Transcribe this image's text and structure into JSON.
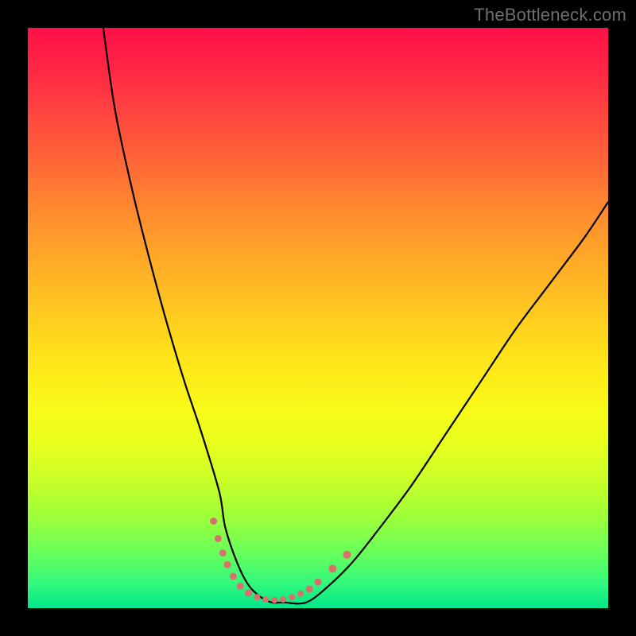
{
  "chart_data": {
    "type": "line",
    "title": "",
    "xlabel": "",
    "ylabel": "",
    "xlim": [
      0,
      100
    ],
    "ylim": [
      0,
      100
    ],
    "series": [
      {
        "name": "bottleneck-curve",
        "x": [
          13,
          15,
          18,
          21,
          24,
          27,
          30,
          33,
          34,
          36,
          38,
          40,
          42,
          44,
          48,
          52,
          56,
          60,
          66,
          72,
          78,
          84,
          90,
          96,
          100
        ],
        "values": [
          100,
          86,
          72,
          60,
          49,
          39,
          30,
          20,
          14,
          8,
          4,
          2,
          1,
          1,
          1,
          4,
          8,
          13,
          21,
          30,
          39,
          48,
          56,
          64,
          70
        ]
      }
    ],
    "markers": {
      "name": "highlighted-points",
      "color": "#d9716b",
      "points": [
        {
          "x": 32.0,
          "y": 15.0,
          "r": 4.5
        },
        {
          "x": 32.8,
          "y": 12.0,
          "r": 4.5
        },
        {
          "x": 33.6,
          "y": 9.5,
          "r": 4.5
        },
        {
          "x": 34.4,
          "y": 7.5,
          "r": 4.5
        },
        {
          "x": 35.4,
          "y": 5.5,
          "r": 4.5
        },
        {
          "x": 36.6,
          "y": 3.8,
          "r": 4.5
        },
        {
          "x": 38.0,
          "y": 2.6,
          "r": 4.5
        },
        {
          "x": 39.5,
          "y": 1.9,
          "r": 4.0
        },
        {
          "x": 41.0,
          "y": 1.5,
          "r": 4.0
        },
        {
          "x": 42.5,
          "y": 1.4,
          "r": 4.0
        },
        {
          "x": 44.0,
          "y": 1.5,
          "r": 4.0
        },
        {
          "x": 45.5,
          "y": 1.9,
          "r": 4.0
        },
        {
          "x": 47.0,
          "y": 2.5,
          "r": 4.0
        },
        {
          "x": 48.5,
          "y": 3.3,
          "r": 4.5
        },
        {
          "x": 50.0,
          "y": 4.5,
          "r": 4.5
        },
        {
          "x": 52.5,
          "y": 6.8,
          "r": 5.0
        },
        {
          "x": 55.0,
          "y": 9.2,
          "r": 5.0
        }
      ]
    },
    "background_gradient": {
      "direction": "top-to-bottom",
      "stops": [
        {
          "pos": 0,
          "color": "#ff0f47"
        },
        {
          "pos": 20,
          "color": "#ff5a3a"
        },
        {
          "pos": 44,
          "color": "#ffb824"
        },
        {
          "pos": 66,
          "color": "#f8fb18"
        },
        {
          "pos": 84,
          "color": "#a0ff38"
        },
        {
          "pos": 100,
          "color": "#00e68a"
        }
      ]
    }
  },
  "watermark": "TheBottleneck.com"
}
